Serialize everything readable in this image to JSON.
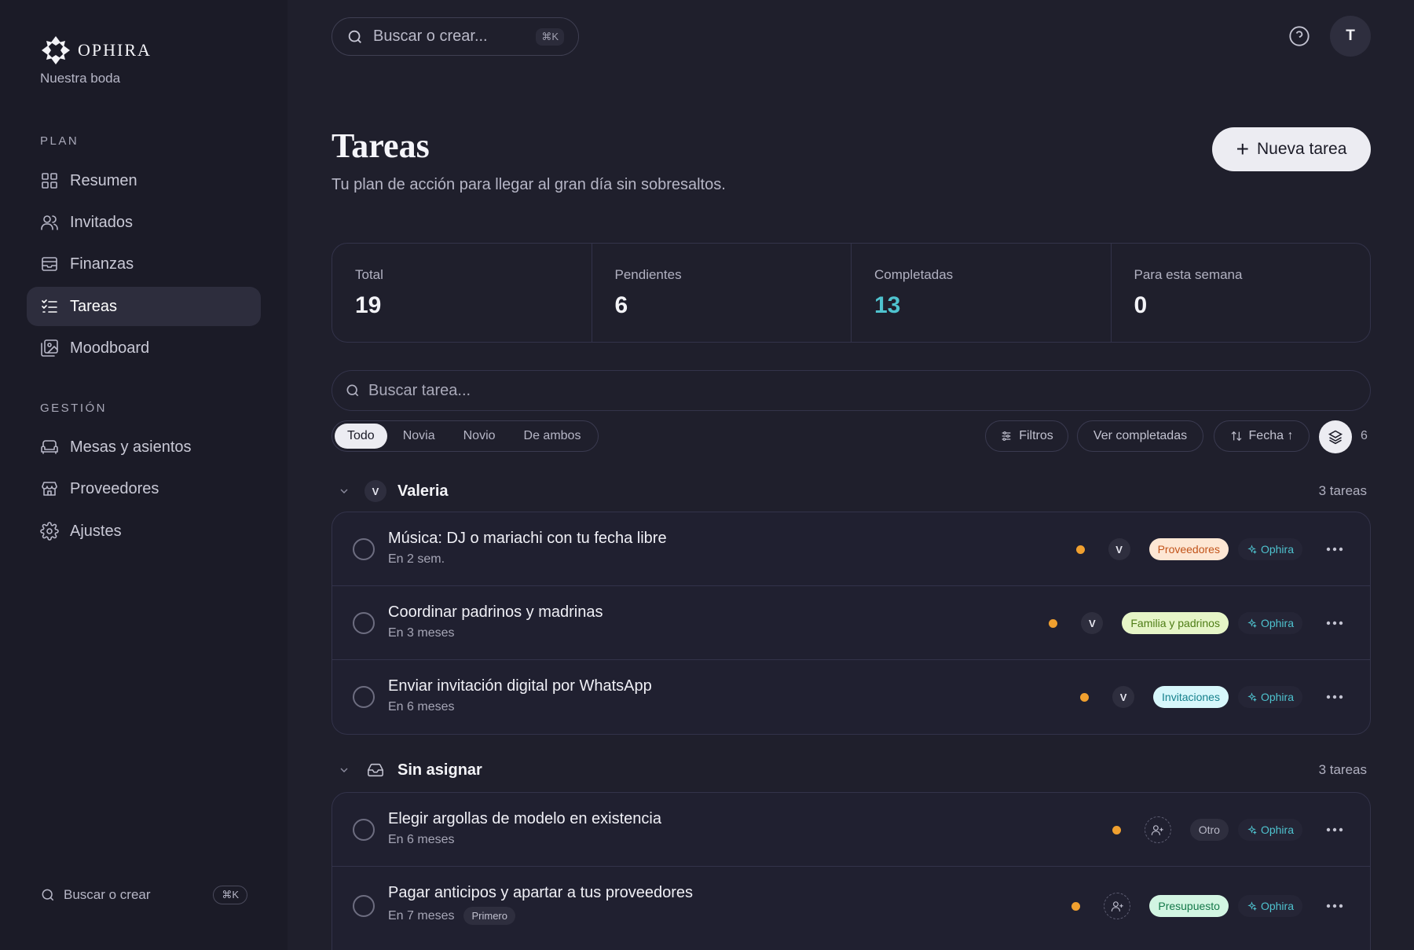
{
  "sidebar": {
    "brand": "OPHIRA",
    "subtitle": "Nuestra boda",
    "plan_label": "PLAN",
    "plan_items": [
      {
        "label": "Resumen",
        "icon": "grid-icon"
      },
      {
        "label": "Invitados",
        "icon": "users-icon"
      },
      {
        "label": "Finanzas",
        "icon": "wallet-icon"
      },
      {
        "label": "Tareas",
        "icon": "checklist-icon",
        "active": true
      },
      {
        "label": "Moodboard",
        "icon": "images-icon"
      }
    ],
    "gestion_label": "GESTIÓN",
    "gestion_items": [
      {
        "label": "Mesas y asientos",
        "icon": "sofa-icon"
      },
      {
        "label": "Proveedores",
        "icon": "store-icon"
      },
      {
        "label": "Ajustes",
        "icon": "gear-icon"
      }
    ],
    "search_label": "Buscar o crear",
    "search_kbd": "⌘K"
  },
  "topbar": {
    "search_placeholder": "Buscar o crear...",
    "search_kbd": "⌘K",
    "avatar_initial": "T"
  },
  "header": {
    "title": "Tareas",
    "subtitle": "Tu plan de acción para llegar al gran día sin sobresaltos.",
    "new_button": "Nueva tarea"
  },
  "stats": [
    {
      "label": "Total",
      "value": "19"
    },
    {
      "label": "Pendientes",
      "value": "6"
    },
    {
      "label": "Completadas",
      "value": "13",
      "accent": "#4fc3cf"
    },
    {
      "label": "Para esta semana",
      "value": "0"
    }
  ],
  "task_search_placeholder": "Buscar tarea...",
  "filters": {
    "segments": [
      "Todo",
      "Novia",
      "Novio",
      "De ambos"
    ],
    "active_segment": "Todo",
    "filters_label": "Filtros",
    "show_completed_label": "Ver completadas",
    "sort_label": "Fecha ↑",
    "group_count": "6"
  },
  "groups": [
    {
      "initial": "V",
      "name": "Valeria",
      "count": "3 tareas",
      "tasks": [
        {
          "title": "Música: DJ o mariachi con tu fecha libre",
          "due": "En 2 sem.",
          "assignee": "V",
          "tag": "Proveedores",
          "tag_class": "tag-proveedores",
          "source": "Ophira"
        },
        {
          "title": "Coordinar padrinos y madrinas",
          "due": "En 3 meses",
          "assignee": "V",
          "tag": "Familia y padrinos",
          "tag_class": "tag-familia",
          "source": "Ophira"
        },
        {
          "title": "Enviar invitación digital por WhatsApp",
          "due": "En 6 meses",
          "assignee": "V",
          "tag": "Invitaciones",
          "tag_class": "tag-invitaciones",
          "source": "Ophira"
        }
      ]
    },
    {
      "initial": "",
      "name": "Sin asignar",
      "count": "3 tareas",
      "tasks": [
        {
          "title": "Elegir argollas de modelo en existencia",
          "due": "En 6 meses",
          "assignee": "",
          "tag": "Otro",
          "tag_class": "tag-otro",
          "source": "Ophira"
        },
        {
          "title": "Pagar anticipos y apartar a tus proveedores",
          "due": "En 7 meses",
          "badge": "Primero",
          "assignee": "",
          "tag": "Presupuesto",
          "tag_class": "tag-presupuesto",
          "source": "Ophira"
        }
      ]
    }
  ],
  "colors": {
    "background": "#1f1f2c",
    "sidebar": "#1b1b27",
    "accent": "#4fc3cf",
    "priority": "#f0a02f"
  }
}
